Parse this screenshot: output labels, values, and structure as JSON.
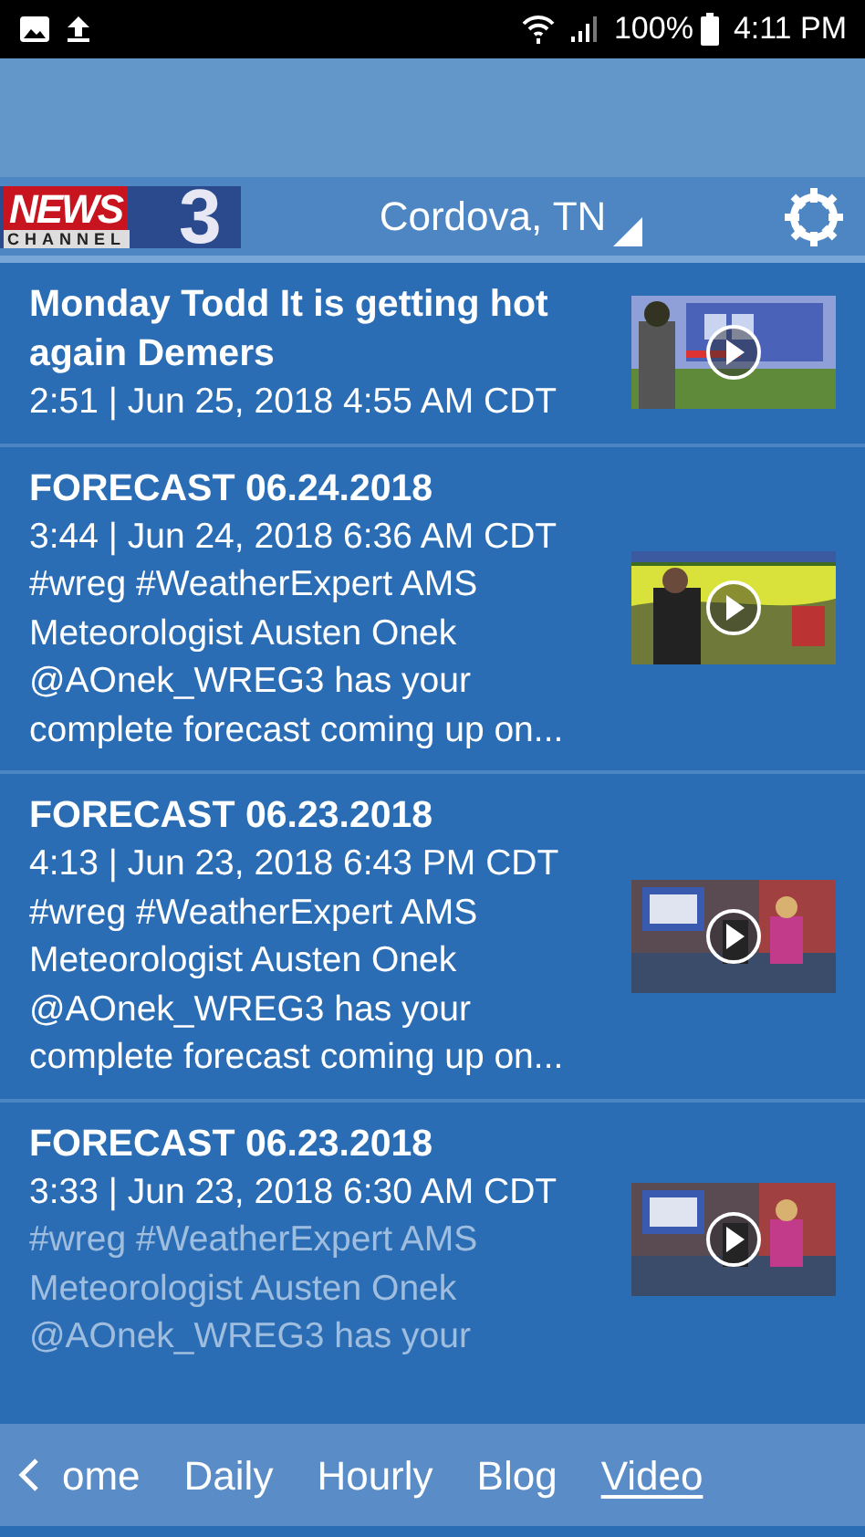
{
  "status_bar": {
    "battery": "100%",
    "time": "4:11 PM"
  },
  "header": {
    "logo": {
      "word": "NEWS",
      "sub": "CHANNEL",
      "number": "3"
    },
    "location": "Cordova, TN"
  },
  "videos": [
    {
      "title": "Monday Todd It is getting hot again Demers",
      "meta": "2:51 | Jun 25, 2018 4:55 AM CDT",
      "faded": false
    },
    {
      "title": "FORECAST 06.24.2018",
      "meta": "3:44 | Jun 24, 2018 6:36 AM CDT",
      "description": "#wreg #WeatherExpert AMS Meteorologist Austen Onek @AOnek_WREG3 has your complete forecast coming up on...",
      "faded": false
    },
    {
      "title": "FORECAST 06.23.2018",
      "meta": "4:13 | Jun 23, 2018 6:43 PM CDT",
      "description": "#wreg #WeatherExpert AMS Meteorologist Austen Onek @AOnek_WREG3 has your complete forecast coming up on...",
      "faded": false
    },
    {
      "title": "FORECAST 06.23.2018",
      "meta": "3:33 | Jun 23, 2018 6:30 AM CDT",
      "description": "#wreg #WeatherExpert AMS Meteorologist Austen Onek @AOnek_WREG3 has your",
      "faded": true
    }
  ],
  "tabs": [
    {
      "label": "ome",
      "selected": false
    },
    {
      "label": "Daily",
      "selected": false
    },
    {
      "label": "Hourly",
      "selected": false
    },
    {
      "label": "Blog",
      "selected": false
    },
    {
      "label": "Video",
      "selected": true
    }
  ]
}
